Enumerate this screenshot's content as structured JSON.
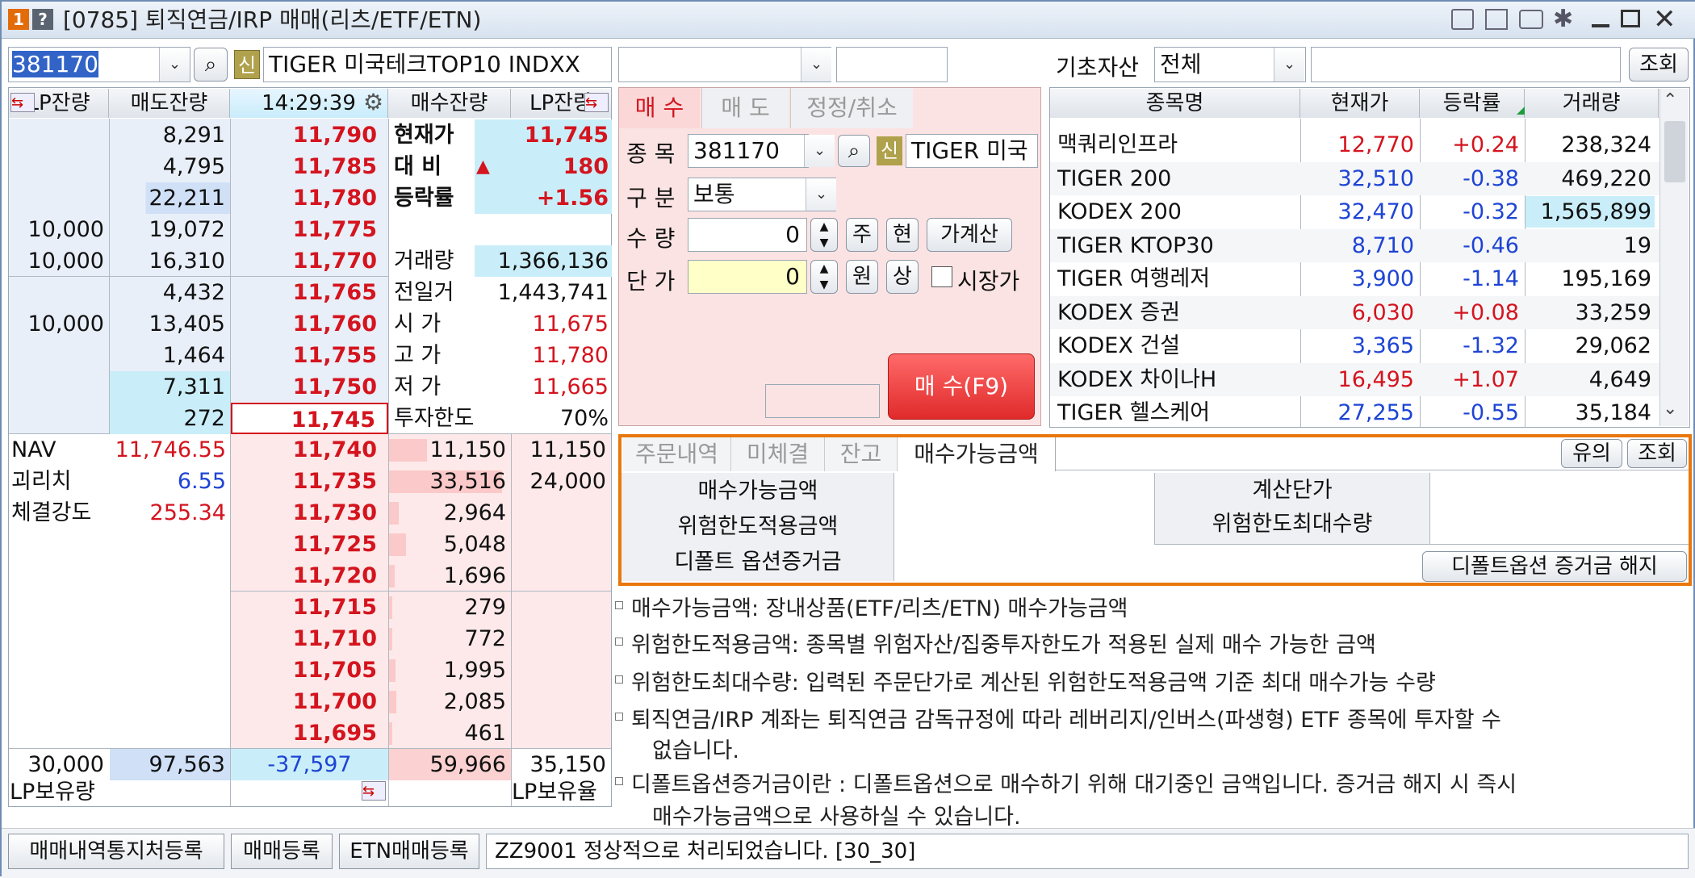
{
  "window": {
    "title": "[0785] 퇴직연금/IRP 매매(리츠/ETF/ETN)",
    "badge1": "1",
    "badge2": "?"
  },
  "search": {
    "code": "381170",
    "new_badge": "신",
    "stock_name": "TIGER 미국테크TOP10 INDXX",
    "underlying_label": "기초자산",
    "underlying_value": "전체",
    "query_button": "조회"
  },
  "orderbook": {
    "headers": {
      "lp_left": "LP잔량",
      "sell": "매도잔량",
      "time": "14:29:39",
      "buy": "매수잔량",
      "lp_right": "LP잔량"
    },
    "ask_rows": [
      {
        "lp": "",
        "qty": "8,291",
        "price": "11,790"
      },
      {
        "lp": "",
        "qty": "4,795",
        "price": "11,785"
      },
      {
        "lp": "",
        "qty": "22,211",
        "price": "11,780"
      },
      {
        "lp": "10,000",
        "qty": "19,072",
        "price": "11,775"
      },
      {
        "lp": "10,000",
        "qty": "16,310",
        "price": "11,770"
      },
      {
        "lp": "",
        "qty": "4,432",
        "price": "11,765"
      },
      {
        "lp": "10,000",
        "qty": "13,405",
        "price": "11,760"
      },
      {
        "lp": "",
        "qty": "1,464",
        "price": "11,755"
      },
      {
        "lp": "",
        "qty": "7,311",
        "price": "11,750"
      },
      {
        "lp": "",
        "qty": "272",
        "price": "11,745"
      }
    ],
    "info": [
      {
        "label": "현재가",
        "value": "11,745"
      },
      {
        "label": "대  비",
        "arrow": "▲",
        "value": "180"
      },
      {
        "label": "등락률",
        "value": "+1.56"
      },
      {
        "label": "",
        "value": ""
      },
      {
        "label": "거래량",
        "value": "1,366,136"
      },
      {
        "label": "전일거",
        "value": "1,443,741"
      },
      {
        "label": "시  가",
        "value": "11,675"
      },
      {
        "label": "고  가",
        "value": "11,780"
      },
      {
        "label": "저  가",
        "value": "11,665"
      },
      {
        "label": "투자한도",
        "value": "70%"
      }
    ],
    "nav": [
      {
        "label": "NAV",
        "value": "11,746.55"
      },
      {
        "label": "괴리치",
        "value": "6.55"
      },
      {
        "label": "체결강도",
        "value": "255.34"
      }
    ],
    "bid_rows": [
      {
        "price": "11,740",
        "qty": "11,150",
        "lp": "11,150"
      },
      {
        "price": "11,735",
        "qty": "33,516",
        "lp": "24,000"
      },
      {
        "price": "11,730",
        "qty": "2,964",
        "lp": ""
      },
      {
        "price": "11,725",
        "qty": "5,048",
        "lp": ""
      },
      {
        "price": "11,720",
        "qty": "1,696",
        "lp": ""
      },
      {
        "price": "11,715",
        "qty": "279",
        "lp": ""
      },
      {
        "price": "11,710",
        "qty": "772",
        "lp": ""
      },
      {
        "price": "11,705",
        "qty": "1,995",
        "lp": ""
      },
      {
        "price": "11,700",
        "qty": "2,085",
        "lp": ""
      },
      {
        "price": "11,695",
        "qty": "461",
        "lp": ""
      }
    ],
    "totals": {
      "lp_left": "30,000",
      "sell": "97,563",
      "diff": "-37,597",
      "buy": "59,966",
      "lp_right": "35,150"
    },
    "footer": {
      "lp_left_label": "LP보유량",
      "lp_right_label": "LP보유율"
    }
  },
  "order_form": {
    "tabs": [
      "매  수",
      "매  도",
      "정정/취소"
    ],
    "stock_label": "종 목",
    "stock_code": "381170",
    "new_badge": "신",
    "stock_name": "TIGER 미국",
    "type_label": "구 분",
    "type_value": "보통",
    "qty_label": "수 량",
    "qty_value": "0",
    "price_label": "단 가",
    "price_value": "0",
    "btn_ju": "주",
    "btn_hyun": "현",
    "btn_calc": "가계산",
    "btn_won": "원",
    "btn_sang": "상",
    "market_price_label": "시장가",
    "submit": "매  수(F9)"
  },
  "stock_list": {
    "columns": [
      "종목명",
      "현재가",
      "등락률",
      "거래량"
    ],
    "rows": [
      {
        "name": "맥쿼리인프라",
        "price": "12,770",
        "rate": "+0.24",
        "volume": "238,324",
        "dir": "up"
      },
      {
        "name": "TIGER 200",
        "price": "32,510",
        "rate": "-0.38",
        "volume": "469,220",
        "dir": "down"
      },
      {
        "name": "KODEX 200",
        "price": "32,470",
        "rate": "-0.32",
        "volume": "1,565,899",
        "dir": "down"
      },
      {
        "name": "TIGER KTOP30",
        "price": "8,710",
        "rate": "-0.46",
        "volume": "19",
        "dir": "down"
      },
      {
        "name": "TIGER 여행레저",
        "price": "3,900",
        "rate": "-1.14",
        "volume": "195,169",
        "dir": "down"
      },
      {
        "name": "KODEX 증권",
        "price": "6,030",
        "rate": "+0.08",
        "volume": "33,259",
        "dir": "up"
      },
      {
        "name": "KODEX 건설",
        "price": "3,365",
        "rate": "-1.32",
        "volume": "29,062",
        "dir": "down"
      },
      {
        "name": "KODEX 차이나H",
        "price": "16,495",
        "rate": "+1.07",
        "volume": "4,649",
        "dir": "up"
      },
      {
        "name": "TIGER 헬스케어",
        "price": "27,255",
        "rate": "-0.55",
        "volume": "35,184",
        "dir": "down"
      }
    ]
  },
  "account_panel": {
    "tabs": [
      "주문내역",
      "미체결",
      "잔고",
      "매수가능금액"
    ],
    "btn_notice": "유의",
    "btn_query": "조회",
    "labels_left": [
      "매수가능금액",
      "위험한도적용금액",
      "디폴트 옵션증거금"
    ],
    "labels_right": [
      "계산단가",
      "위험한도최대수량"
    ],
    "release_button": "디폴트옵션 증거금 해지"
  },
  "notes": [
    "매수가능금액: 장내상품(ETF/리츠/ETN) 매수가능금액",
    "위험한도적용금액: 종목별 위험자산/집중투자한도가 적용된 실제 매수 가능한 금액",
    "위험한도최대수량: 입력된 주문단가로 계산된 위험한도적용금액 기준 최대 매수가능 수량",
    "퇴직연금/IRP 계좌는 퇴직연금 감독규정에 따라 레버리지/인버스(파생형) ETF 종목에 투자할 수",
    "없습니다.",
    "디폴트옵션증거금이란 : 디폴트옵션으로 매수하기 위해 대기중인 금액입니다. 증거금 해지 시 즉시",
    "매수가능금액으로 사용하실 수 있습니다."
  ],
  "statusbar": {
    "btn1": "매매내역통지처등록",
    "btn2": "매매등록",
    "btn3": "ETN매매등록",
    "message": "ZZ9001 정상적으로 처리되었습니다. [30_30]"
  },
  "colors": {
    "up": "#d4141e",
    "down": "#1e44d4",
    "highlight": "#e8770c"
  }
}
